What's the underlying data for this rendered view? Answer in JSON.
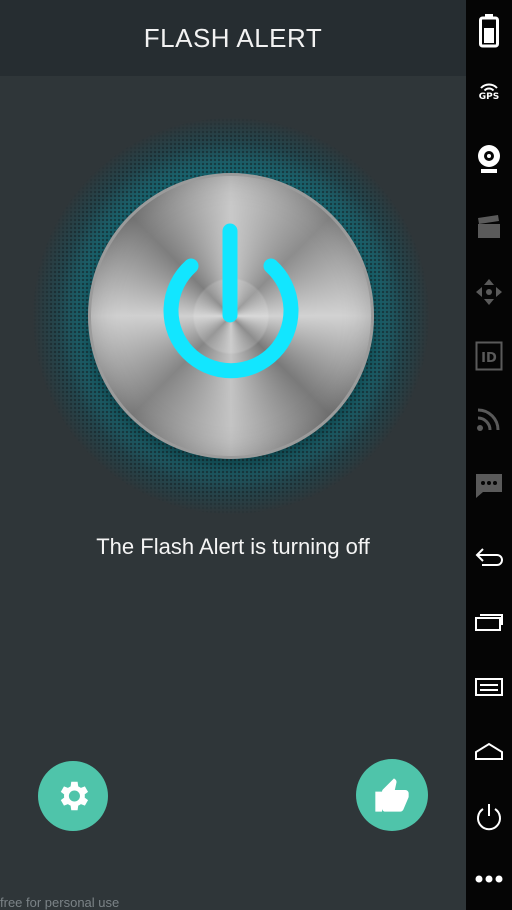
{
  "app": {
    "title": "FLASH ALERT",
    "status_message": "The Flash Alert is turning off",
    "footer_note": "free for personal use"
  },
  "power_button": {
    "icon": "power-icon",
    "state": "off"
  },
  "actions": [
    {
      "icon": "gear-icon"
    },
    {
      "icon": "thumbs-up-icon"
    }
  ],
  "system_bar": {
    "gps_label": "GPS",
    "id_label": "ID",
    "icons": [
      "battery-icon",
      "gps-icon",
      "webcam-icon",
      "clapperboard-icon",
      "dpad-icon",
      "id-icon",
      "rss-icon",
      "message-icon",
      "back-icon",
      "recent-apps-icon",
      "menu-icon",
      "home-icon",
      "power-icon",
      "more-icon"
    ]
  },
  "colors": {
    "accent_cyan": "#00e5ff",
    "fab_green": "#4fc4aa",
    "titlebar": "#262d31",
    "background": "#2f3639",
    "system_bar": "#050505"
  }
}
